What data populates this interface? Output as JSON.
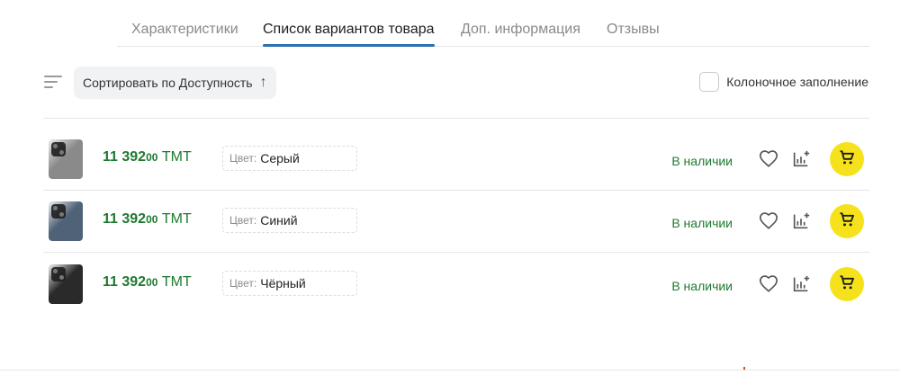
{
  "tabs": [
    {
      "label": "Характеристики",
      "active": false
    },
    {
      "label": "Список вариантов товара",
      "active": true
    },
    {
      "label": "Доп. информация",
      "active": false
    },
    {
      "label": "Отзывы",
      "active": false
    }
  ],
  "sort": {
    "label": "Сортировать по Доступность",
    "direction": "ascending",
    "arrow": "↑"
  },
  "column_fill": {
    "label": "Колоночное заполнение",
    "checked": false
  },
  "variants": [
    {
      "price_main": "11 392",
      "price_cents": "00",
      "currency": "TMT",
      "spec_label": "Цвет:",
      "spec_value": "Серый",
      "stock": "В наличии",
      "thumb_color": "#8a8a8a"
    },
    {
      "price_main": "11 392",
      "price_cents": "00",
      "currency": "TMT",
      "spec_label": "Цвет:",
      "spec_value": "Синий",
      "stock": "В наличии",
      "thumb_color": "#4f6278"
    },
    {
      "price_main": "11 392",
      "price_cents": "00",
      "currency": "TMT",
      "spec_label": "Цвет:",
      "spec_value": "Чёрный",
      "stock": "В наличии",
      "thumb_color": "#2a2a2a"
    }
  ],
  "colors": {
    "accent_green": "#1e7a2e",
    "active_tab_underline": "#2c6fb0",
    "cart_yellow": "#f6e21c"
  }
}
